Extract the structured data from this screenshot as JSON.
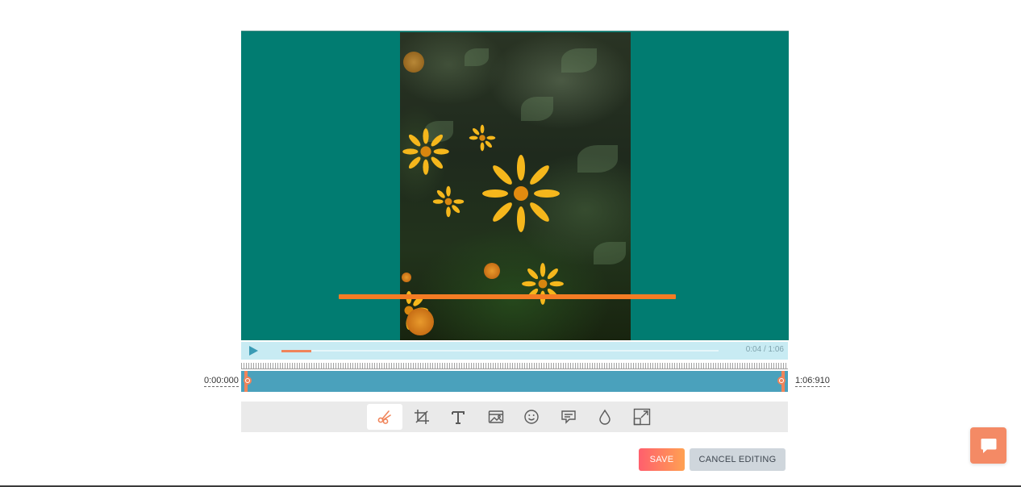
{
  "player": {
    "current_time": "0:04",
    "duration": "1:06",
    "time_separator": " / ",
    "progress_fraction": 0.068
  },
  "trim": {
    "start_label": "0:00:000",
    "end_label": "1:06:910"
  },
  "tools": [
    {
      "name": "cut-icon",
      "active": true
    },
    {
      "name": "crop-icon",
      "active": false
    },
    {
      "name": "text-icon",
      "active": false
    },
    {
      "name": "image-icon",
      "active": false
    },
    {
      "name": "emoji-icon",
      "active": false
    },
    {
      "name": "speech-bubble-icon",
      "active": false
    },
    {
      "name": "drop-icon",
      "active": false
    },
    {
      "name": "resize-icon",
      "active": false
    }
  ],
  "actions": {
    "save_label": "SAVE",
    "cancel_label": "CANCEL EDITING"
  },
  "colors": {
    "video_background": "#017c71",
    "accent_orange": "#f47c24",
    "range_blue": "#4aa1bc",
    "controls_bg": "#c8ebf3",
    "save_gradient_start": "#ff5f6d",
    "save_gradient_end": "#ffa152",
    "chat_button": "#f48a65"
  }
}
